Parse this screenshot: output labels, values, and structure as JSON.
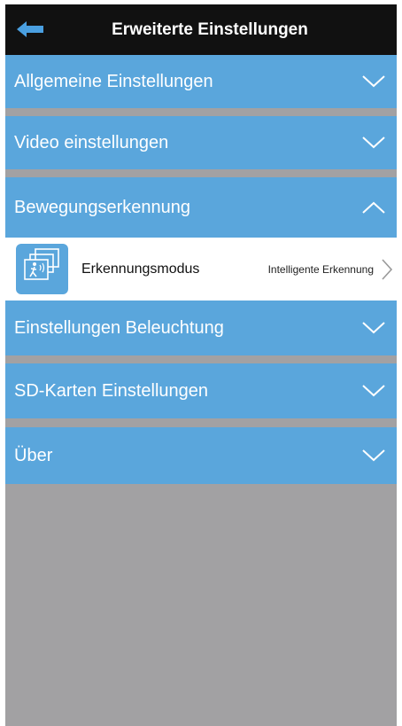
{
  "header": {
    "title": "Erweiterte Einstellungen",
    "back_icon": "back-arrow-icon"
  },
  "sections": [
    {
      "label": "Allgemeine Einstellungen",
      "expanded": false
    },
    {
      "label": "Video einstellungen",
      "expanded": false
    },
    {
      "label": "Bewegungserkennung",
      "expanded": true
    },
    {
      "label": "Einstellungen Beleuchtung",
      "expanded": false
    },
    {
      "label": "SD-Karten Einstellungen",
      "expanded": false
    },
    {
      "label": "Über",
      "expanded": false
    }
  ],
  "motion_detection": {
    "item_label": "Erkennungsmodus",
    "item_value": "Intelligente Erkennung",
    "icon": "motion-detection-icon"
  },
  "colors": {
    "header_bg": "#111111",
    "section_bg": "#5aa6dc",
    "background": "#a2a1a3",
    "item_bg": "#ffffff"
  }
}
